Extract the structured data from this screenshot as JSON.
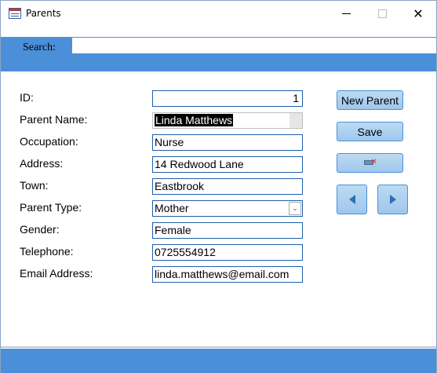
{
  "window": {
    "title": "Parents",
    "icon": "form-icon",
    "controls": {
      "minimize": "minimize-icon",
      "maximize": "maximize-icon",
      "close": "✕"
    }
  },
  "search": {
    "label": "Search:",
    "value": ""
  },
  "form": {
    "id": {
      "label": "ID:",
      "value": "1"
    },
    "parent_name": {
      "label": "Parent Name:",
      "value": "Linda Matthews"
    },
    "occupation": {
      "label": "Occupation:",
      "value": "Nurse"
    },
    "address": {
      "label": "Address:",
      "value": "14 Redwood Lane"
    },
    "town": {
      "label": "Town:",
      "value": "Eastbrook"
    },
    "parent_type": {
      "label": "Parent Type:",
      "value": "Mother"
    },
    "gender": {
      "label": "Gender:",
      "value": "Female"
    },
    "telephone": {
      "label": "Telephone:",
      "value": "0725554912"
    },
    "email": {
      "label": "Email Address:",
      "value": "linda.matthews@email.com"
    }
  },
  "buttons": {
    "new_parent": "New Parent",
    "save": "Save",
    "delete_icon": "delete-record-icon",
    "previous_icon": "previous-arrow-icon",
    "next_icon": "next-arrow-icon"
  },
  "colors": {
    "header": "#4a8fd8",
    "field_border": "#1e5fa8",
    "button_fill": "#b0d2f0"
  }
}
